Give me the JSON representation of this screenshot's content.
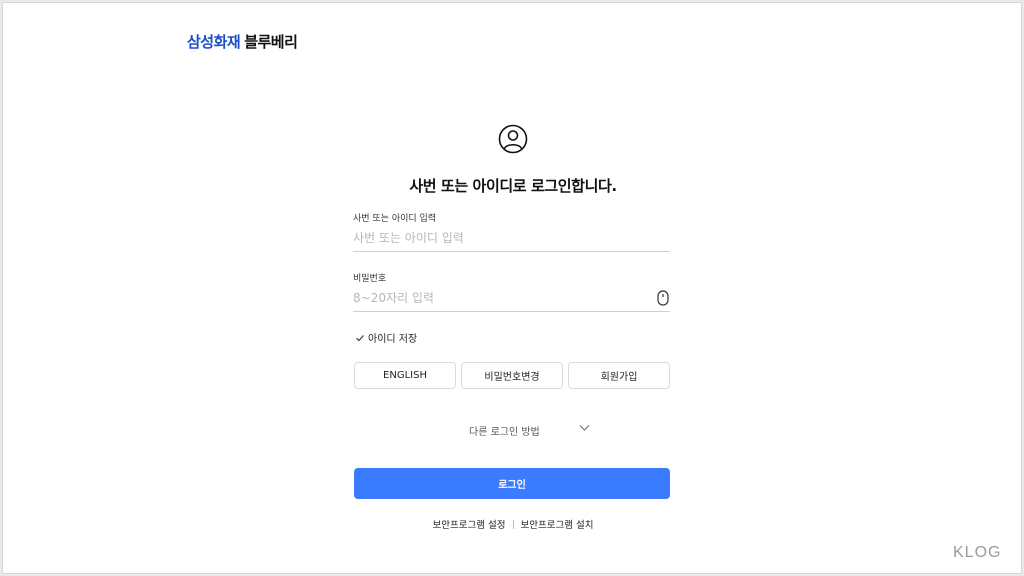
{
  "brand": {
    "part1": "삼성화재",
    "part2": "블루베리"
  },
  "header": {
    "title": "사번 또는 아이디로 로그인합니다."
  },
  "form": {
    "id_label": "사번 또는 아이디 입력",
    "id_placeholder": "사번 또는 아이디 입력",
    "id_value": "",
    "password_label": "비밀번호",
    "password_placeholder": "8~20자리 입력",
    "password_value": "",
    "save_id_label": "아이디 저장"
  },
  "buttons": {
    "english": "ENGLISH",
    "change_password": "비밀번호변경",
    "signup": "회원가입",
    "login": "로그인"
  },
  "other_login": {
    "label": "다른 로그인 방법"
  },
  "footer": {
    "security_settings": "보안프로그램 설정",
    "security_install": "보안프로그램 설치"
  },
  "watermark": "KLOG",
  "icons": {
    "person": "person-circle-icon",
    "eye": "eye-icon",
    "check": "check-icon",
    "chevron": "chevron-down-icon"
  },
  "colors": {
    "brand_blue": "#1a4fc9",
    "login_button": "#3a7bff"
  }
}
